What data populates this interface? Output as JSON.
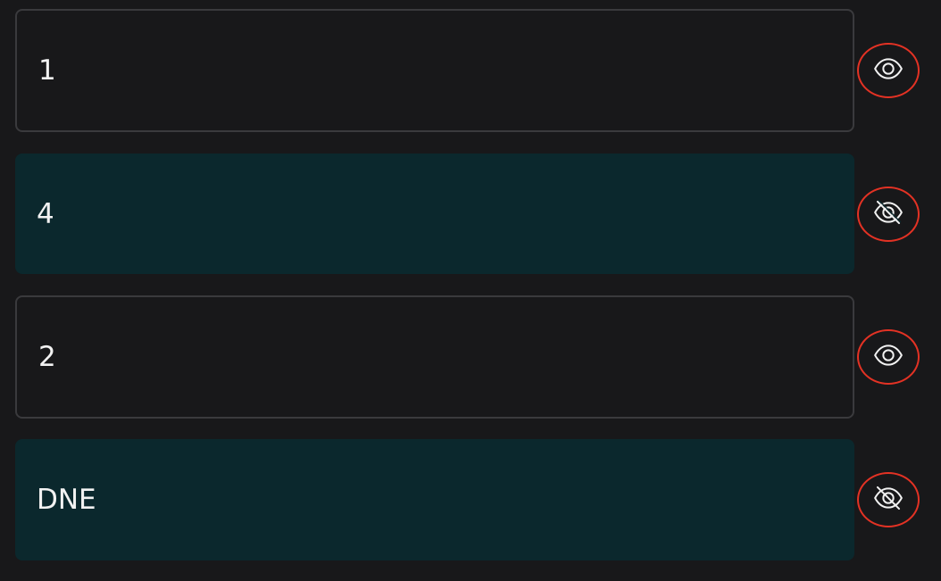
{
  "rows": [
    {
      "value": "1",
      "state": "visible",
      "icon": "eye-icon"
    },
    {
      "value": "4",
      "state": "hidden",
      "icon": "eye-slash-icon"
    },
    {
      "value": "2",
      "state": "visible",
      "icon": "eye-icon"
    },
    {
      "value": "DNE",
      "state": "hidden",
      "icon": "eye-slash-icon"
    }
  ],
  "colors": {
    "background": "#18181a",
    "hidden_fill": "#0b282d",
    "border": "#3a3a3d",
    "toggle_outline": "#e33224",
    "text": "#f2f2f2"
  }
}
